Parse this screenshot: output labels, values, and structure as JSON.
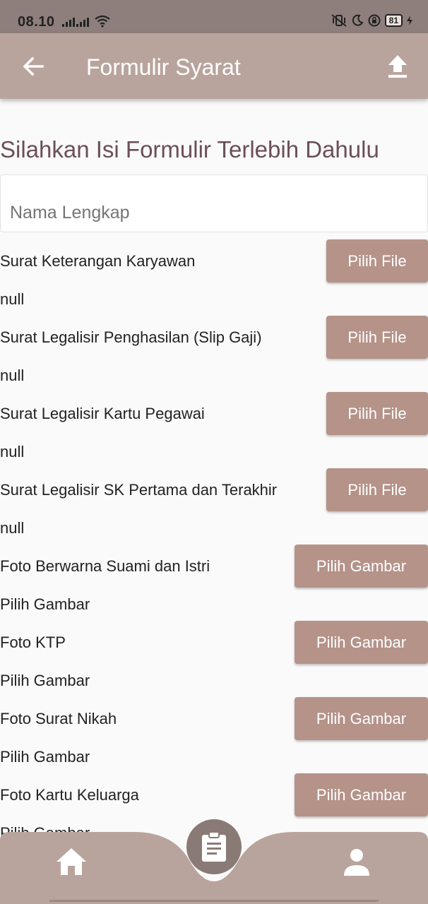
{
  "status_bar": {
    "time": "08.10",
    "battery": "81"
  },
  "app_bar": {
    "title": "Formulir Syarat",
    "back_icon": "arrow-left-icon",
    "action_icon": "upload-icon"
  },
  "form": {
    "heading": "Silahkan Isi Formulir Terlebih Dahulu",
    "name_placeholder": "Nama Lengkap",
    "rows": [
      {
        "label": "Surat Keterangan Karyawan",
        "button": "Pilih File",
        "status": "null"
      },
      {
        "label": "Surat Legalisir Penghasilan (Slip Gaji)",
        "button": "Pilih File",
        "status": "null"
      },
      {
        "label": "Surat Legalisir Kartu Pegawai",
        "button": "Pilih File",
        "status": "null"
      },
      {
        "label": "Surat Legalisir SK Pertama dan Terakhir",
        "button": "Pilih File",
        "status": "null"
      },
      {
        "label": "Foto Berwarna Suami dan Istri",
        "button": "Pilih Gambar",
        "status": "Pilih Gambar"
      },
      {
        "label": "Foto KTP",
        "button": "Pilih Gambar",
        "status": "Pilih Gambar"
      },
      {
        "label": "Foto Surat Nikah",
        "button": "Pilih Gambar",
        "status": "Pilih Gambar"
      },
      {
        "label": "Foto Kartu Keluarga",
        "button": "Pilih Gambar",
        "status": "Pilih Gambar"
      }
    ]
  },
  "bottom_nav": {
    "items": [
      "home-icon",
      "clipboard-icon",
      "person-icon"
    ]
  },
  "colors": {
    "app_bar": "#b9a49d",
    "button": "#b59389",
    "heading": "#6b4f57",
    "nav": "#b9a49d",
    "fab": "#8a7a76"
  }
}
